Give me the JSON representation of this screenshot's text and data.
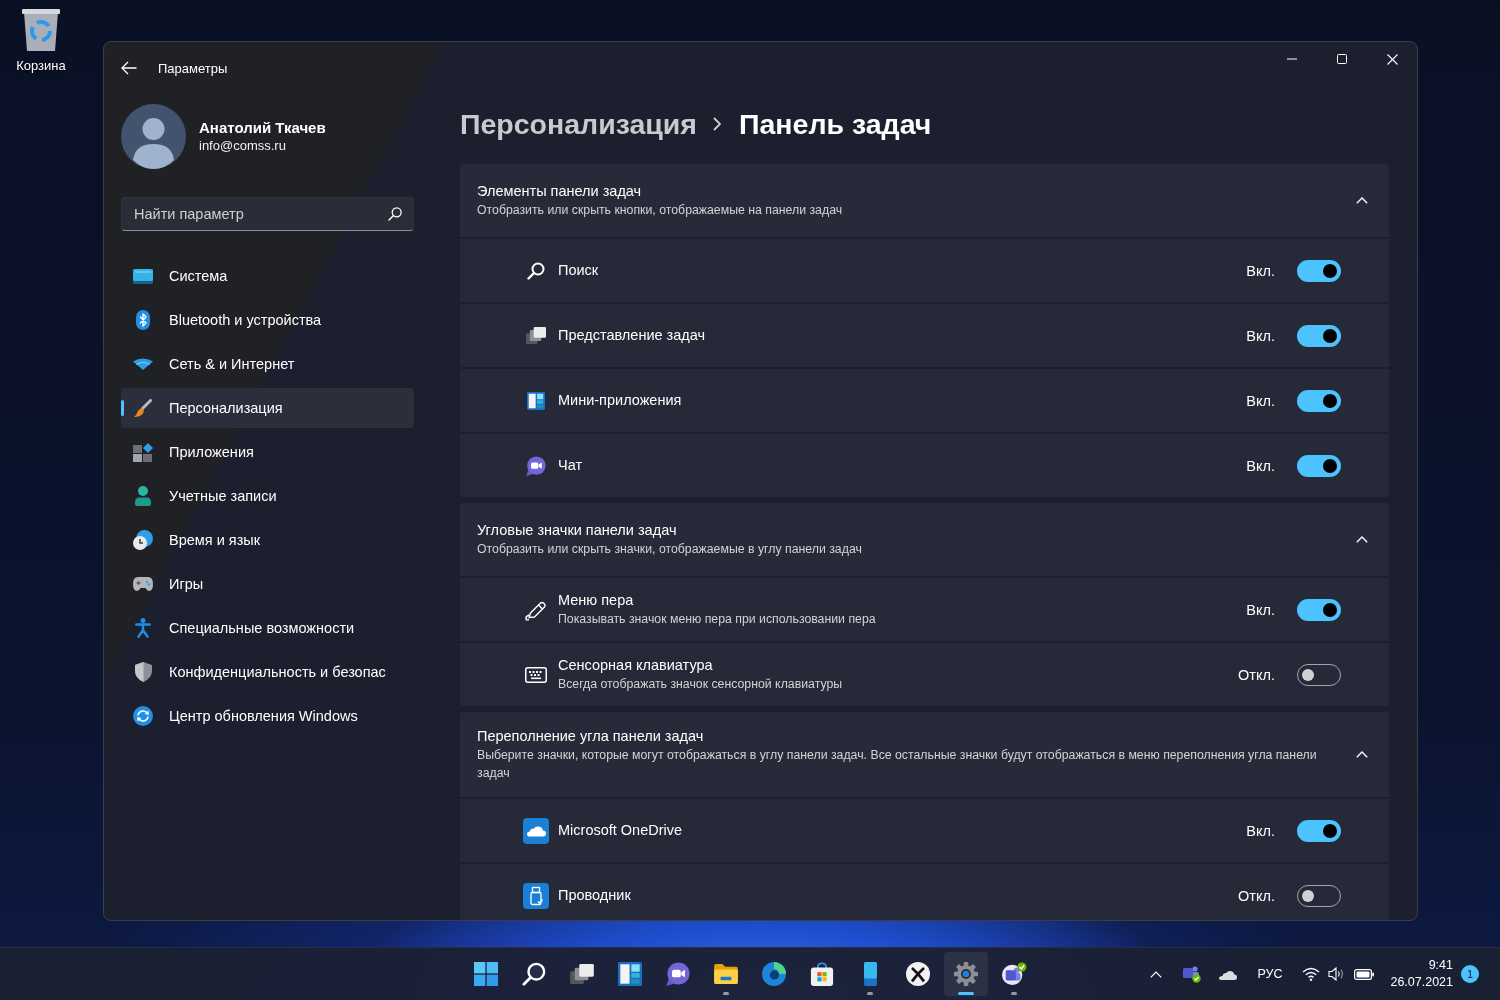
{
  "desktop": {
    "icons": [
      {
        "label": "Корзина"
      }
    ]
  },
  "window": {
    "title": "Параметры"
  },
  "account": {
    "name": "Анатолий Ткачев",
    "email": "info@comss.ru"
  },
  "search": {
    "placeholder": "Найти параметр"
  },
  "sidebar": {
    "items": [
      {
        "label": "Система",
        "kind": "system",
        "selected": false
      },
      {
        "label": "Bluetooth и устройства",
        "kind": "bluetooth",
        "selected": false
      },
      {
        "label": "Сеть & и Интернет",
        "kind": "network",
        "selected": false
      },
      {
        "label": "Персонализация",
        "kind": "personalization",
        "selected": true
      },
      {
        "label": "Приложения",
        "kind": "apps",
        "selected": false
      },
      {
        "label": "Учетные записи",
        "kind": "accounts",
        "selected": false
      },
      {
        "label": "Время и язык",
        "kind": "time",
        "selected": false
      },
      {
        "label": "Игры",
        "kind": "gaming",
        "selected": false
      },
      {
        "label": "Специальные возможности",
        "kind": "accessibility",
        "selected": false
      },
      {
        "label": "Конфиденциальность и безопас",
        "kind": "privacy",
        "selected": false
      },
      {
        "label": "Центр обновления Windows",
        "kind": "update",
        "selected": false
      }
    ]
  },
  "breadcrumb": {
    "parent": "Персонализация",
    "current": "Панель задач"
  },
  "sections": [
    {
      "title": "Элементы панели задач",
      "subtitle": "Отобразить или скрыть кнопки, отображаемые на панели задач",
      "expanded": true,
      "rows": [
        {
          "kind": "search",
          "label": "Поиск",
          "status": "Вкл.",
          "on": true
        },
        {
          "kind": "taskview",
          "label": "Представление задач",
          "status": "Вкл.",
          "on": true
        },
        {
          "kind": "widgets",
          "label": "Мини-приложения",
          "status": "Вкл.",
          "on": true
        },
        {
          "kind": "chat",
          "label": "Чат",
          "status": "Вкл.",
          "on": true
        }
      ]
    },
    {
      "title": "Угловые значки панели задач",
      "subtitle": "Отобразить или скрыть значки, отображаемые в углу панели задач",
      "expanded": true,
      "rows": [
        {
          "kind": "pen",
          "label": "Меню пера",
          "description": "Показывать значок меню пера при использовании пера",
          "status": "Вкл.",
          "on": true
        },
        {
          "kind": "keyboard",
          "label": "Сенсорная клавиатура",
          "description": "Всегда отображать значок сенсорной клавиатуры",
          "status": "Откл.",
          "on": false
        }
      ]
    },
    {
      "title": "Переполнение угла панели задач",
      "subtitle": "Выберите значки, которые могут отображаться в углу панели задач. Все остальные значки будут отображаться в меню переполнения угла панели задач",
      "expanded": true,
      "rows": [
        {
          "kind": "onedrive",
          "label": "Microsoft OneDrive",
          "status": "Вкл.",
          "on": true
        },
        {
          "kind": "explorer",
          "label": "Проводник",
          "status": "Откл.",
          "on": false
        }
      ]
    }
  ],
  "taskbar": {
    "apps": [
      {
        "kind": "start",
        "running": false,
        "selected": false
      },
      {
        "kind": "search",
        "running": false,
        "selected": false
      },
      {
        "kind": "taskview",
        "running": false,
        "selected": false
      },
      {
        "kind": "widgets",
        "running": false,
        "selected": false
      },
      {
        "kind": "chat",
        "running": false,
        "selected": false
      },
      {
        "kind": "explorer",
        "running": true,
        "selected": false
      },
      {
        "kind": "edge",
        "running": false,
        "selected": false
      },
      {
        "kind": "store",
        "running": false,
        "selected": false
      },
      {
        "kind": "phone",
        "running": true,
        "selected": false
      },
      {
        "kind": "xbox",
        "running": false,
        "selected": false
      },
      {
        "kind": "settings",
        "running": true,
        "selected": true
      },
      {
        "kind": "teams",
        "running": true,
        "selected": false
      }
    ],
    "tray": {
      "language": "РУС",
      "time": "9:41",
      "date": "26.07.2021",
      "notifications": "1"
    }
  }
}
